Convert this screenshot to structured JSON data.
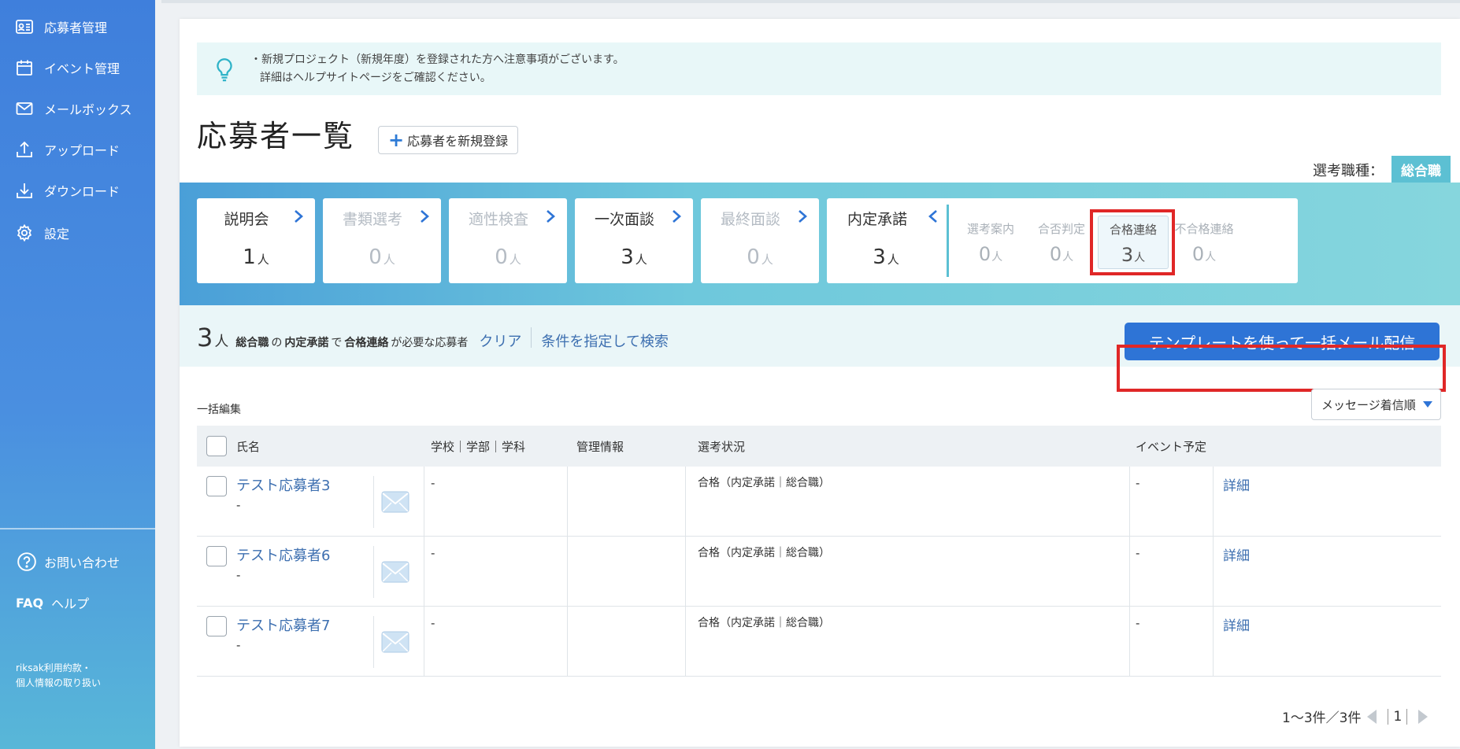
{
  "sidebar": {
    "nav": [
      {
        "label": "応募者管理",
        "icon": "applicant-card-icon"
      },
      {
        "label": "イベント管理",
        "icon": "calendar-icon"
      },
      {
        "label": "メールボックス",
        "icon": "mail-icon"
      },
      {
        "label": "アップロード",
        "icon": "upload-icon"
      },
      {
        "label": "ダウンロード",
        "icon": "download-icon"
      },
      {
        "label": "設定",
        "icon": "gear-icon"
      }
    ],
    "support": {
      "contact_label": "お問い合わせ",
      "faq_badge": "FAQ",
      "help_label": "ヘルプ"
    },
    "legal_line1": "riksak利用約款・",
    "legal_line2": "個人情報の取り扱い"
  },
  "notice": {
    "line1": "・新規プロジェクト（新規年度）を登録された方へ注意事項がございます。",
    "line2": "詳細はヘルプサイトページをご確認ください。"
  },
  "header": {
    "title": "応募者一覧",
    "add_button": "応募者を新規登録",
    "job_type_label": "選考職種：",
    "job_type_value": "総合職"
  },
  "stages": [
    {
      "label": "説明会",
      "count": "1",
      "dim": false
    },
    {
      "label": "書類選考",
      "count": "0",
      "dim": true
    },
    {
      "label": "適性検査",
      "count": "0",
      "dim": true
    },
    {
      "label": "一次面談",
      "count": "3",
      "dim": false
    },
    {
      "label": "最終面談",
      "count": "0",
      "dim": true
    }
  ],
  "offer_stage": {
    "label": "内定承諾",
    "count": "3",
    "sub": [
      {
        "label": "選考案内",
        "count": "0"
      },
      {
        "label": "合否判定",
        "count": "0"
      },
      {
        "label": "合格連絡",
        "count": "3"
      },
      {
        "label": "不合格連絡",
        "count": "0"
      }
    ]
  },
  "unit": "人",
  "filter": {
    "count": "3",
    "unit": "人",
    "job_type": "総合職",
    "particle1": "の",
    "stage": "内定承諾",
    "particle2": "で",
    "sub_stage": "合格連絡",
    "suffix": "が必要な応募者",
    "clear": "クリア",
    "search": "条件を指定して検索",
    "bulk_mail_button": "テンプレートを使って一括メール配信"
  },
  "list": {
    "bulk_edit": "一括編集",
    "sort_label": "メッセージ着信順",
    "columns": {
      "name": "氏名",
      "school": "学校｜学部｜学科",
      "admin": "管理情報",
      "status": "選考状況",
      "event": "イベント予定"
    },
    "rows": [
      {
        "name": "テスト応募者3",
        "sub": "-",
        "school": "-",
        "status": "合格（内定承諾｜総合職）",
        "event": "-",
        "detail": "詳細"
      },
      {
        "name": "テスト応募者6",
        "sub": "-",
        "school": "-",
        "status": "合格（内定承諾｜総合職）",
        "event": "-",
        "detail": "詳細"
      },
      {
        "name": "テスト応募者7",
        "sub": "-",
        "school": "-",
        "status": "合格（内定承諾｜総合職）",
        "event": "-",
        "detail": "詳細"
      }
    ]
  },
  "pagination": {
    "summary": "1～3件／3件",
    "current": "1"
  },
  "colors": {
    "primary": "#2e74d6",
    "accent_teal": "#5cc0d3",
    "highlight_red": "#e02727",
    "link": "#3d6fb0"
  }
}
